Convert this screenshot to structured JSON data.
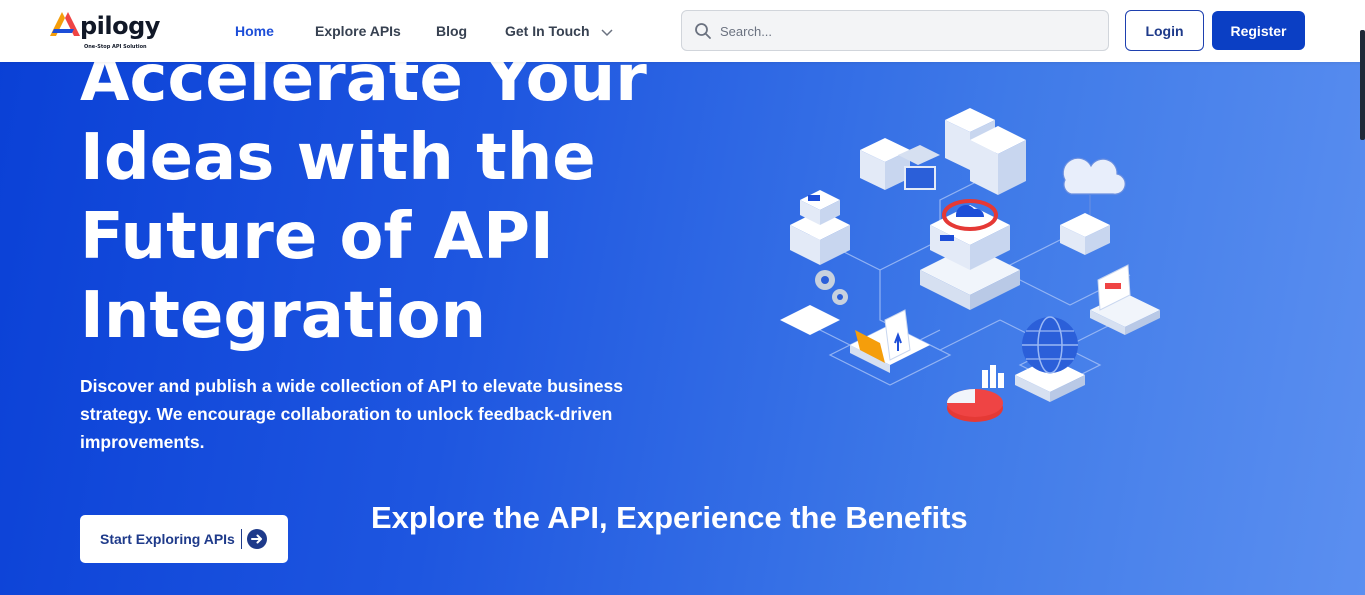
{
  "brand": {
    "name": "pilogy",
    "tagline": "One-Stop API Solution",
    "colors": {
      "accent_orange": "#f59e0b",
      "accent_red": "#ef4444",
      "accent_blue": "#1d4ed8"
    }
  },
  "nav": {
    "items": [
      {
        "label": "Home",
        "active": true
      },
      {
        "label": "Explore APIs",
        "active": false
      },
      {
        "label": "Blog",
        "active": false
      },
      {
        "label": "Get In Touch",
        "active": false,
        "has_dropdown": true
      }
    ]
  },
  "search": {
    "placeholder": "Search...",
    "value": ""
  },
  "auth": {
    "login_label": "Login",
    "register_label": "Register"
  },
  "hero": {
    "title_lines": [
      "Accelerate Your",
      "Ideas with the",
      "Future of API",
      "Integration"
    ],
    "description": "Discover and publish a wide collection of API to elevate business strategy. We encourage collaboration to unlock feedback-driven improvements.",
    "cta_label": "Start Exploring APIs",
    "cta_icon": "arrow-right-circle-icon",
    "gradient": {
      "start": "#0a40d6",
      "end": "#5b8ff0"
    }
  },
  "section": {
    "heading": "Explore the API, Experience the Benefits"
  },
  "icons": [
    "search-icon",
    "chevron-down-icon",
    "arrow-right-circle-icon",
    "api-network-illustration"
  ]
}
